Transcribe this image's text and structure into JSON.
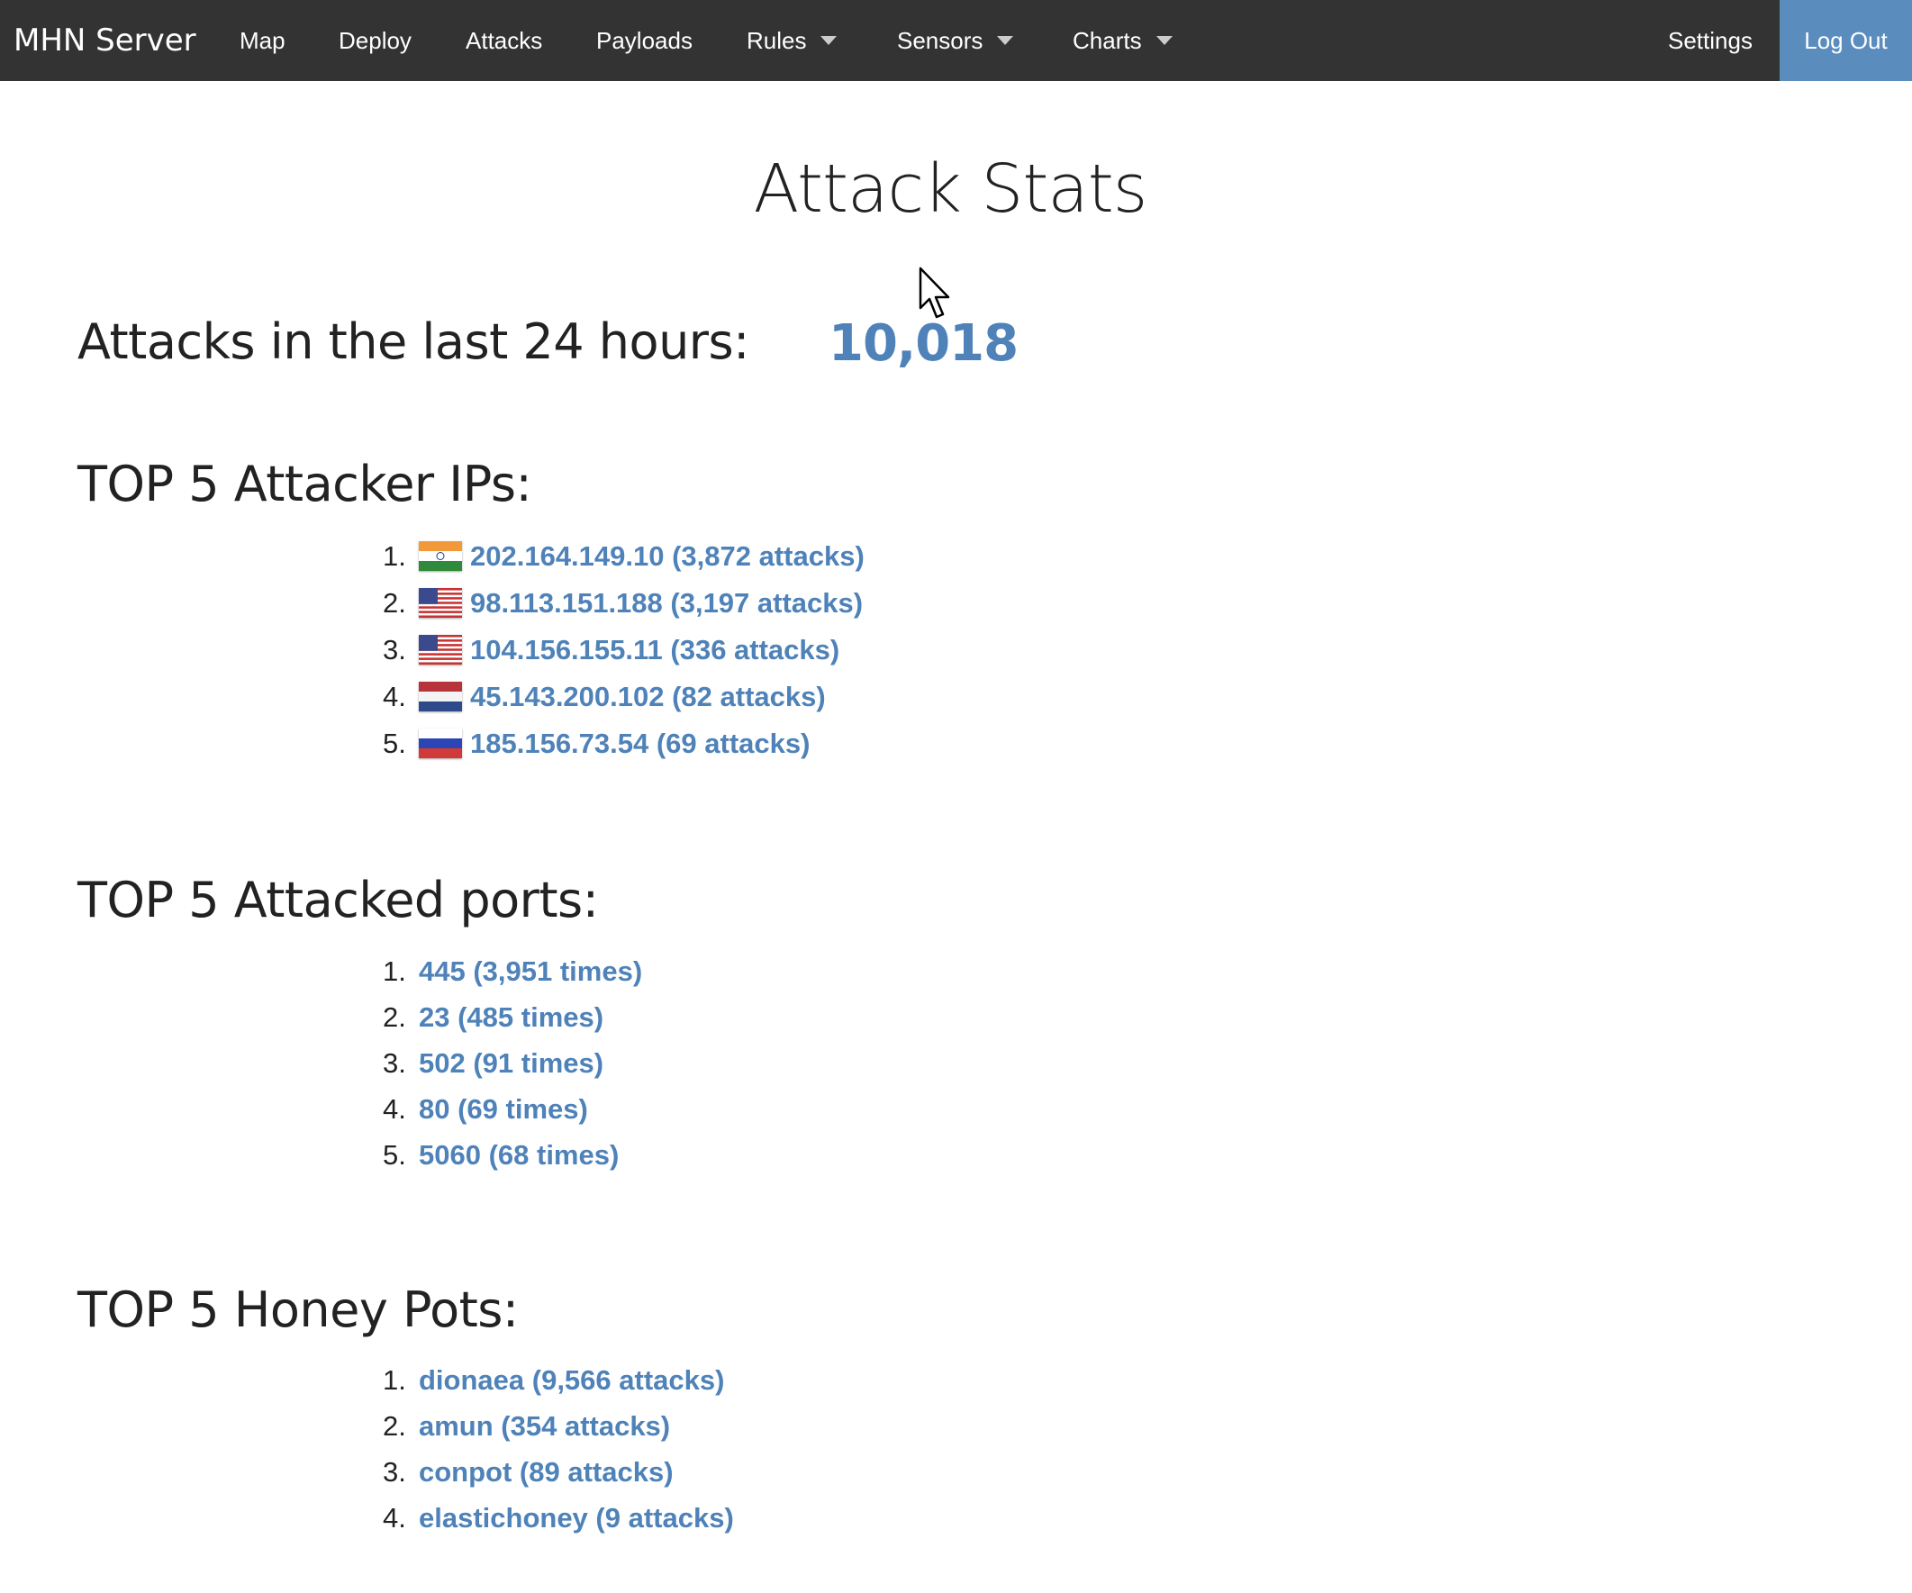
{
  "nav": {
    "brand": "MHN Server",
    "items": [
      {
        "label": "Map"
      },
      {
        "label": "Deploy"
      },
      {
        "label": "Attacks"
      },
      {
        "label": "Payloads"
      },
      {
        "label": "Rules"
      },
      {
        "label": "Sensors"
      },
      {
        "label": "Charts"
      }
    ],
    "settings": "Settings",
    "logout": "Log Out",
    "accent_color": "#5a8dbd"
  },
  "page": {
    "title": "Attack Stats"
  },
  "summary": {
    "label": "Attacks in the last 24 hours:",
    "count": "10,018"
  },
  "top_ips": {
    "heading": "TOP 5 Attacker IPs:",
    "items": [
      {
        "num": "1.",
        "text": "202.164.149.10 (3,872 attacks)",
        "flag": "india-flag-icon"
      },
      {
        "num": "2.",
        "text": "98.113.151.188 (3,197 attacks)",
        "flag": "usa-flag-icon"
      },
      {
        "num": "3.",
        "text": "104.156.155.11 (336 attacks)",
        "flag": "usa-flag-icon"
      },
      {
        "num": "4.",
        "text": "45.143.200.102 (82 attacks)",
        "flag": "netherlands-flag-icon"
      },
      {
        "num": "5.",
        "text": "185.156.73.54 (69 attacks)",
        "flag": "russia-flag-icon"
      }
    ]
  },
  "top_ports": {
    "heading": "TOP 5 Attacked ports:",
    "items": [
      {
        "num": "1.",
        "text": "445 (3,951 times)"
      },
      {
        "num": "2.",
        "text": "23 (485 times)"
      },
      {
        "num": "3.",
        "text": "502 (91 times)"
      },
      {
        "num": "4.",
        "text": "80 (69 times)"
      },
      {
        "num": "5.",
        "text": "5060 (68 times)"
      }
    ]
  },
  "top_honeypots": {
    "heading": "TOP 5 Honey Pots:",
    "items": [
      {
        "num": "1.",
        "text": "dionaea (9,566 attacks)"
      },
      {
        "num": "2.",
        "text": "amun (354 attacks)"
      },
      {
        "num": "3.",
        "text": "conpot (89 attacks)"
      },
      {
        "num": "4.",
        "text": "elastichoney (9 attacks)"
      }
    ]
  },
  "colors": {
    "navbar_bg": "#333333",
    "link": "#4e82b8",
    "heading": "#222222"
  }
}
